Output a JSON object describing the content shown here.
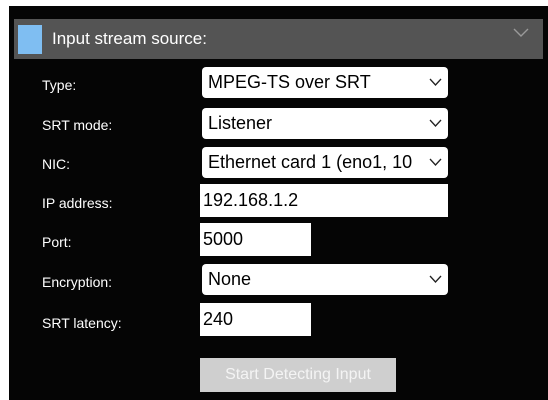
{
  "panel": {
    "title": "Input stream source:",
    "collapse_icon": "chevron-down-icon"
  },
  "fields": {
    "type": {
      "label": "Type:",
      "value": "MPEG-TS over SRT"
    },
    "srt_mode": {
      "label": "SRT mode:",
      "value": "Listener"
    },
    "nic": {
      "label": "NIC:",
      "value": "Ethernet card 1 (eno1, 10"
    },
    "ip_address": {
      "label": "IP address:",
      "value": "192.168.1.2"
    },
    "port": {
      "label": "Port:",
      "value": "5000"
    },
    "encryption": {
      "label": "Encryption:",
      "value": "None"
    },
    "srt_latency": {
      "label": "SRT latency:",
      "value": "240"
    }
  },
  "actions": {
    "start_detecting_label": "Start Detecting Input"
  },
  "colors": {
    "accent": "#7fbef2",
    "header_bg": "#545454",
    "panel_bg": "#050505",
    "disabled_button": "#cfcfcf"
  }
}
